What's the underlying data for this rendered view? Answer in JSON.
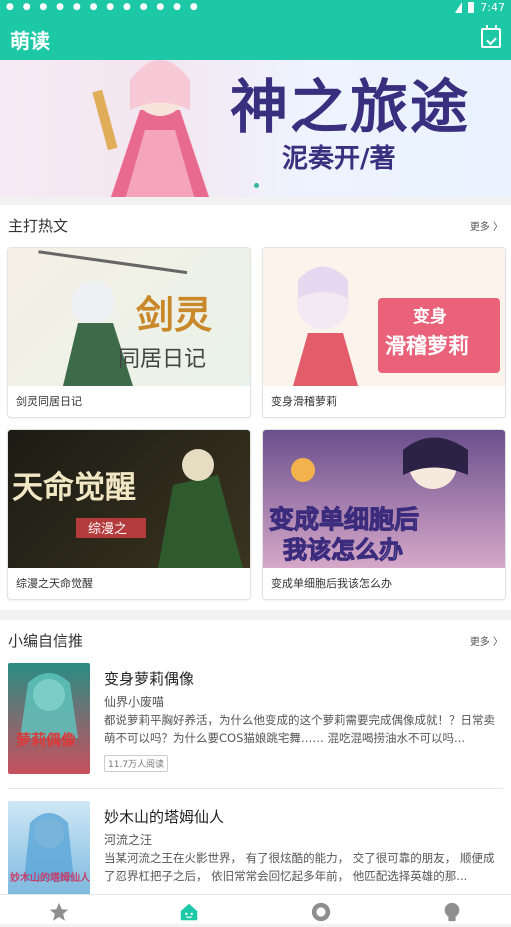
{
  "app": {
    "title": "萌读"
  },
  "statusbar": {
    "time": "7:47"
  },
  "banner": {
    "title": "神之旅途",
    "author": "泥奏开/著"
  },
  "featured": {
    "title": "主打热文",
    "more": "更多",
    "items": [
      {
        "caption": "剑灵同居日记",
        "cover_text": "剑灵",
        "cover_sub": "同居日记"
      },
      {
        "caption": "变身滑稽萝莉",
        "cover_text": "变身",
        "cover_sub": "滑稽萝莉"
      },
      {
        "caption": "综漫之天命觉醒",
        "cover_text": "天命觉醒",
        "cover_sub": "综漫之"
      },
      {
        "caption": "变成单细胞后我该怎么办",
        "cover_text": "变成单细胞后",
        "cover_sub": "我该怎么办"
      }
    ]
  },
  "editor": {
    "title": "小编自信推",
    "more": "更多",
    "items": [
      {
        "title": "变身萝莉偶像",
        "author": "仙界小废喵",
        "desc": "都说萝莉平胸好养活，为什么他变成的这个萝莉需要完成偶像成就！？日常卖萌不可以吗？为什么要COS猫娘跳宅舞…… 混吃混喝捞油水不可以吗...",
        "reads": "11.7万人阅读",
        "cover_text": "萝莉偶像"
      },
      {
        "title": "妙木山的塔姆仙人",
        "author": "河流之汪",
        "desc": "当某河流之王在火影世界， 有了很炫酷的能力， 交了很可靠的朋友， 顺便成了忍界杠把子之后， 依旧常常会回忆起多年前， 他匹配选择英雄的那...",
        "cover_text": "妙木山的塔姆仙人"
      }
    ]
  },
  "tabs": [
    {
      "icon": "star-icon"
    },
    {
      "icon": "home-icon"
    },
    {
      "icon": "search-icon"
    },
    {
      "icon": "bulb-icon"
    }
  ],
  "colors": {
    "accent": "#1dc8a6"
  }
}
